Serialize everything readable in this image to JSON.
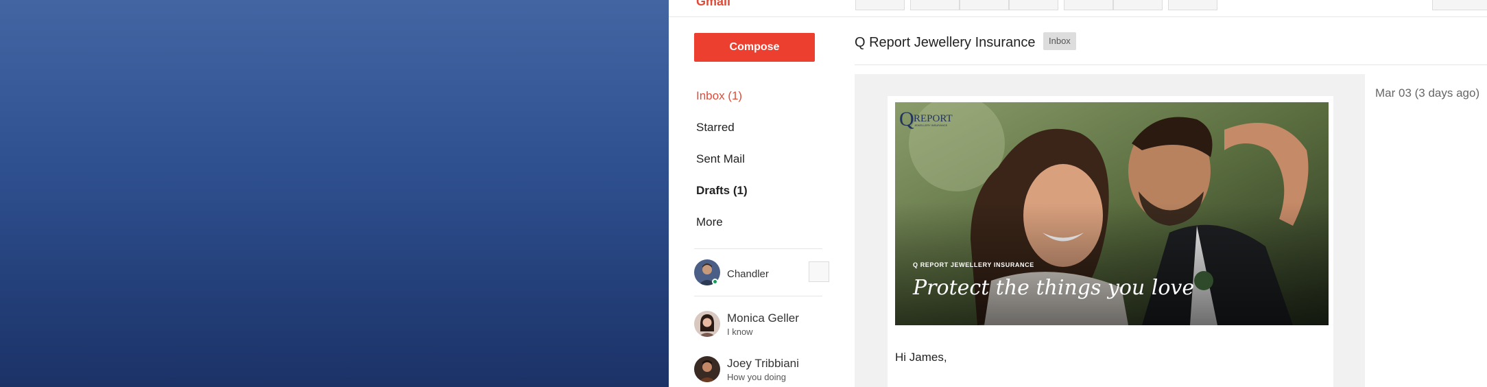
{
  "app": {
    "logo": "Gmail"
  },
  "sidebar": {
    "compose_label": "Compose",
    "nav": [
      {
        "label": "Inbox (1)",
        "state": "active"
      },
      {
        "label": "Starred"
      },
      {
        "label": "Sent Mail"
      },
      {
        "label": "Drafts (1)",
        "state": "bold"
      },
      {
        "label": "More"
      }
    ],
    "contacts": [
      {
        "name": "Chandler",
        "status": "online"
      },
      {
        "name": "Monica Geller",
        "message": "I know"
      },
      {
        "name": "Joey Tribbiani",
        "message": "How you doing"
      }
    ]
  },
  "email": {
    "subject": "Q Report Jewellery Insurance",
    "label": "Inbox",
    "date": "Mar 03 (3 days ago)",
    "greeting": "Hi James,",
    "hero": {
      "logo_letter": "Q",
      "logo_word": "REPORT",
      "logo_sub": "JEWELLERY INSURANCE",
      "tagline": "Q REPORT JEWELLERY INSURANCE",
      "headline": "Protect the things you love"
    }
  },
  "colors": {
    "accent": "#dd4b39",
    "compose": "#ec3f2f",
    "online": "#0f9d58",
    "desktop_top": "#4366a3",
    "desktop_bottom": "#1b3267"
  }
}
